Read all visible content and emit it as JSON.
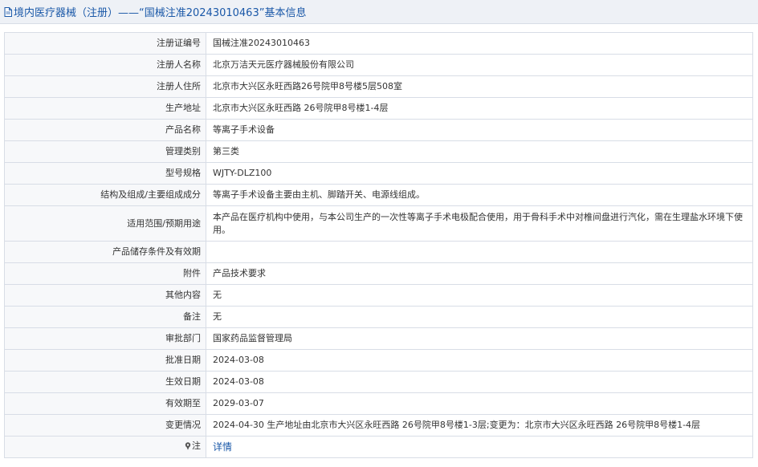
{
  "header": {
    "title": "境内医疗器械（注册）——“国械注准20243010463”基本信息",
    "icon": "document-icon"
  },
  "rows": [
    {
      "label": "注册证编号",
      "value": "国械注准20243010463"
    },
    {
      "label": "注册人名称",
      "value": "北京万洁天元医疗器械股份有限公司"
    },
    {
      "label": "注册人住所",
      "value": "北京市大兴区永旺西路26号院甲8号楼5层508室"
    },
    {
      "label": "生产地址",
      "value": "北京市大兴区永旺西路 26号院甲8号楼1-4层"
    },
    {
      "label": "产品名称",
      "value": "等离子手术设备"
    },
    {
      "label": "管理类别",
      "value": "第三类"
    },
    {
      "label": "型号规格",
      "value": "WJTY-DLZ100"
    },
    {
      "label": "结构及组成/主要组成成分",
      "value": "等离子手术设备主要由主机、脚踏开关、电源线组成。"
    },
    {
      "label": "适用范围/预期用途",
      "value": "本产品在医疗机构中使用，与本公司生产的一次性等离子手术电极配合使用，用于骨科手术中对椎间盘进行汽化，需在生理盐水环境下使用。"
    },
    {
      "label": "产品储存条件及有效期",
      "value": ""
    },
    {
      "label": "附件",
      "value": "产品技术要求"
    },
    {
      "label": "其他内容",
      "value": "无"
    },
    {
      "label": "备注",
      "value": "无"
    },
    {
      "label": "审批部门",
      "value": "国家药品监督管理局"
    },
    {
      "label": "批准日期",
      "value": "2024-03-08"
    },
    {
      "label": "生效日期",
      "value": "2024-03-08"
    },
    {
      "label": "有效期至",
      "value": "2029-03-07"
    },
    {
      "label": "变更情况",
      "value": "2024-04-30 生产地址由北京市大兴区永旺西路 26号院甲8号楼1-3层;变更为：北京市大兴区永旺西路 26号院甲8号楼1-4层"
    }
  ],
  "note": {
    "label": "注",
    "link_text": "详情",
    "icon": "pin-icon"
  }
}
